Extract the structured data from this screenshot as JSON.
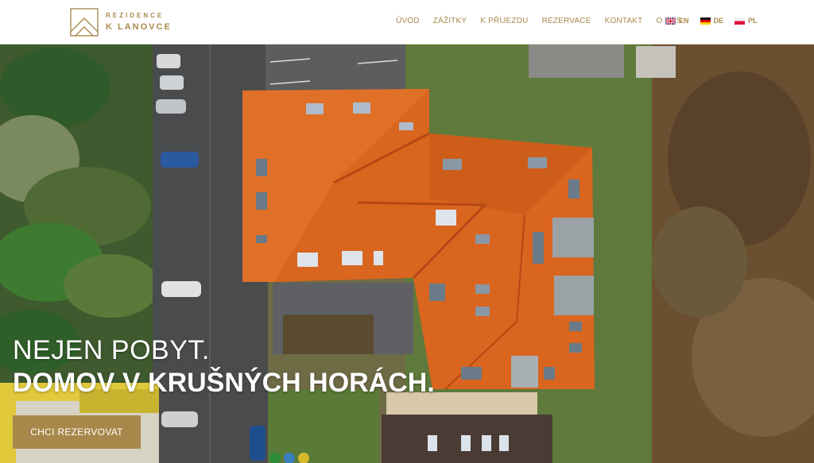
{
  "brand": {
    "line1": "REZIDENCE",
    "line2": "K LANOVCE",
    "logo_icon": "house-roof-logo-icon",
    "color": "#a88a4e"
  },
  "nav": {
    "items": [
      "ÚVOD",
      "ZÁŽITKY",
      "K PŘÍJEZDU",
      "REZERVACE",
      "KONTAKT",
      "O NÁS"
    ]
  },
  "languages": [
    {
      "code": "EN",
      "flag": "uk-flag-icon"
    },
    {
      "code": "DE",
      "flag": "germany-flag-icon"
    },
    {
      "code": "PL",
      "flag": "poland-flag-icon"
    }
  ],
  "hero": {
    "line1": "NEJEN POBYT.",
    "line2": "DOMOV V KRUŠNÝCH HORÁCH.",
    "cta_label": "CHCI REZERVOVAT",
    "accent": "#a8874a",
    "roof_color": "#d9651f"
  }
}
